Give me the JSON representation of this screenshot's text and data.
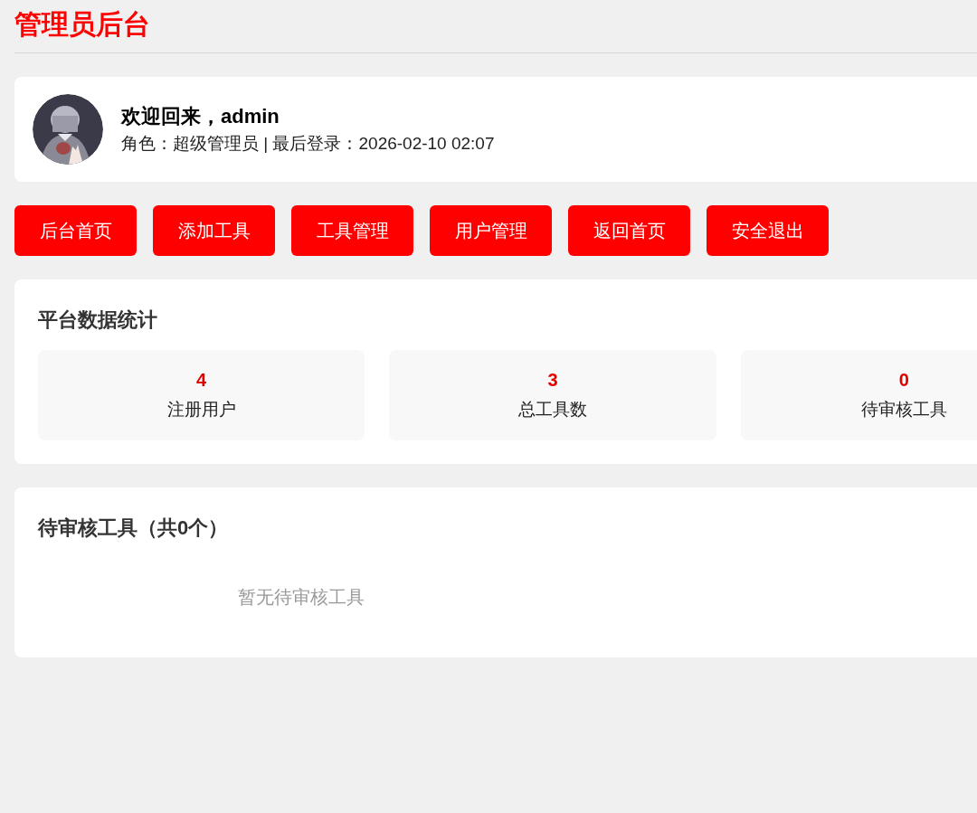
{
  "header": {
    "title": "管理员后台"
  },
  "profile": {
    "greeting": "欢迎回来，admin",
    "info": "角色：超级管理员 | 最后登录：2026-02-10 02:07"
  },
  "nav_buttons": [
    "后台首页",
    "添加工具",
    "工具管理",
    "用户管理",
    "返回首页",
    "安全退出"
  ],
  "stats": {
    "title": "平台数据统计",
    "items": [
      {
        "value": "4",
        "label": "注册用户"
      },
      {
        "value": "3",
        "label": "总工具数"
      },
      {
        "value": "0",
        "label": "待审核工具"
      }
    ]
  },
  "pending": {
    "title": "待审核工具（共0个）",
    "empty_text": "暂无待审核工具"
  }
}
